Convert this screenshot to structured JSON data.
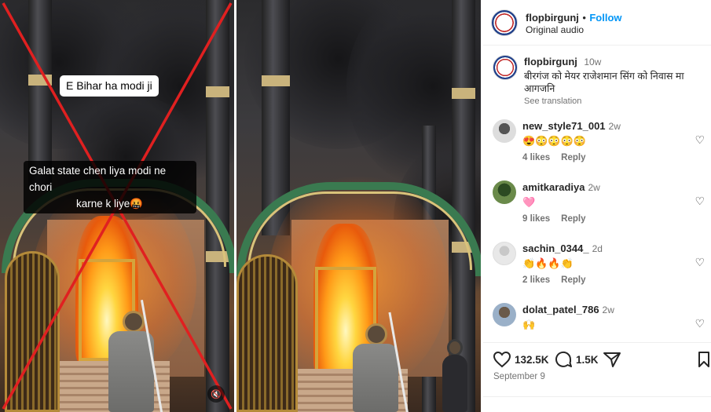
{
  "left_image": {
    "caption_top": "E  Bihar  ha modi ji",
    "caption_bottom_line1": "Galat state chen liya modi ne chori",
    "caption_bottom_line2": "karne k liye🤬",
    "overlay_mark": "red-x",
    "mute_icon": "speaker-muted-icon"
  },
  "post": {
    "username": "flopbirgunj",
    "separator": "•",
    "follow_label": "Follow",
    "audio_label": "Original audio",
    "more_icon": "more-horizontal-icon",
    "caption_username": "flopbirgunj",
    "caption_time": "10w",
    "caption_text": "बीरगंज को मेयर राजेशमान सिंग को निवास मा आगजनि",
    "see_translation": "See translation"
  },
  "comments": [
    {
      "username": "new_style71_001",
      "time": "2w",
      "text": "😍😳😳😳😳",
      "likes": "4 likes",
      "reply": "Reply"
    },
    {
      "username": "amitkaradiya",
      "time": "2w",
      "text": "🩷",
      "likes": "9 likes",
      "reply": "Reply"
    },
    {
      "username": "sachin_0344_",
      "time": "2d",
      "text": "👏🔥🔥👏",
      "likes": "2 likes",
      "reply": "Reply"
    },
    {
      "username": "dolat_patel_786",
      "time": "2w",
      "text": "🙌",
      "likes": "",
      "reply": ""
    }
  ],
  "actions": {
    "like_icon": "heart-icon",
    "like_count": "132.5K",
    "comment_icon": "comment-icon",
    "comment_count": "1.5K",
    "share_icon": "send-icon",
    "save_icon": "bookmark-icon"
  },
  "date": "September 9",
  "colors": {
    "follow": "#0095f6",
    "muted_text": "#737373",
    "red_x": "#e02020"
  }
}
